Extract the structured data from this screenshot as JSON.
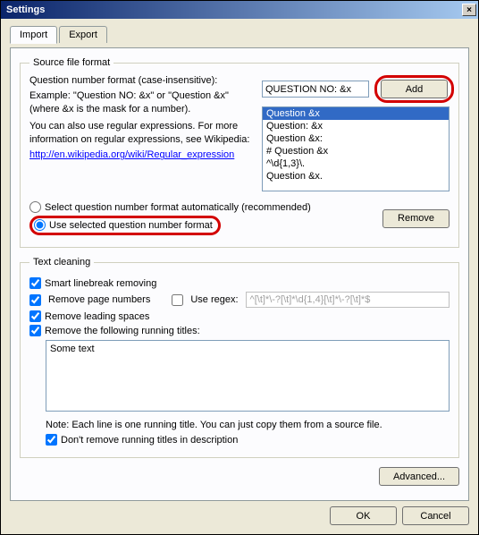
{
  "window": {
    "title": "Settings",
    "close": "×"
  },
  "tabs": {
    "import": "Import",
    "export": "Export"
  },
  "source": {
    "legend": "Source file format",
    "qformat_label": "Question number format (case-insensitive):",
    "qformat_value": "QUESTION NO: &x",
    "add_btn": "Add",
    "help1": "Example: \"Question NO: &x\" or \"Question &x\" (where &x is the mask for a number).",
    "help2": "You can also use regular expressions. For more information on regular expressions, see Wikipedia:",
    "wiki_link": "http://en.wikipedia.org/wiki/Regular_expression",
    "list": [
      "Question &x",
      "Question: &x",
      "Question &x:",
      "# Question &x",
      "^\\d{1,3}\\.",
      "Question &x."
    ],
    "radio_auto": "Select question number format automatically (recommended)",
    "radio_selected": "Use selected question number format",
    "remove_btn": "Remove"
  },
  "clean": {
    "legend": "Text cleaning",
    "smart": "Smart linebreak removing",
    "remove_pages": "Remove page numbers",
    "use_regex_label": "Use regex:",
    "regex_value": "^[\\t]*\\-?[\\t]*\\d{1,4}[\\t]*\\-?[\\t]*$",
    "leading": "Remove leading spaces",
    "running": "Remove the following running titles:",
    "running_text": "Some text",
    "note": "Note: Each line is one running title. You can just copy them from a source file.",
    "dont_remove_desc": "Don't remove running titles in description"
  },
  "buttons": {
    "advanced": "Advanced...",
    "ok": "OK",
    "cancel": "Cancel"
  }
}
